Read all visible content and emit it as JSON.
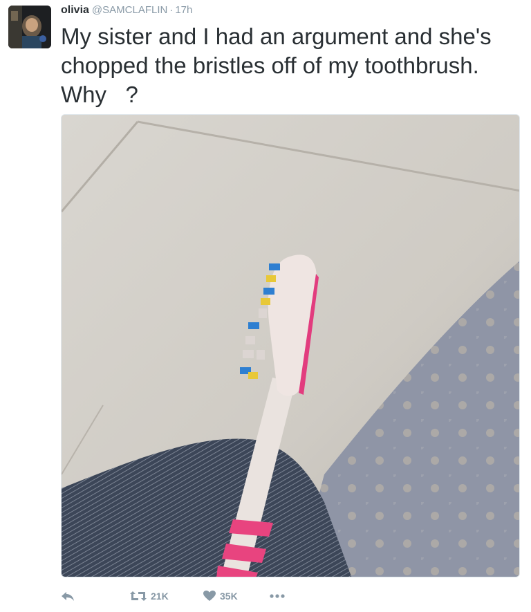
{
  "tweet": {
    "display_name": "olivia",
    "handle": "@SAMCLAFLIN",
    "separator": "·",
    "time": "17h",
    "text": "My sister and I had an argument and she's chopped the bristles off of my toothbrush. Why   ?"
  },
  "actions": {
    "retweets": "21K",
    "likes": "35K"
  },
  "colors": {
    "text": "#292f33",
    "muted": "#8899a6",
    "border": "#e1e8ed"
  },
  "icons": {
    "reply": "reply-arrow-icon",
    "retweet": "retweet-icon",
    "like": "heart-icon",
    "more": "ellipsis-icon"
  }
}
